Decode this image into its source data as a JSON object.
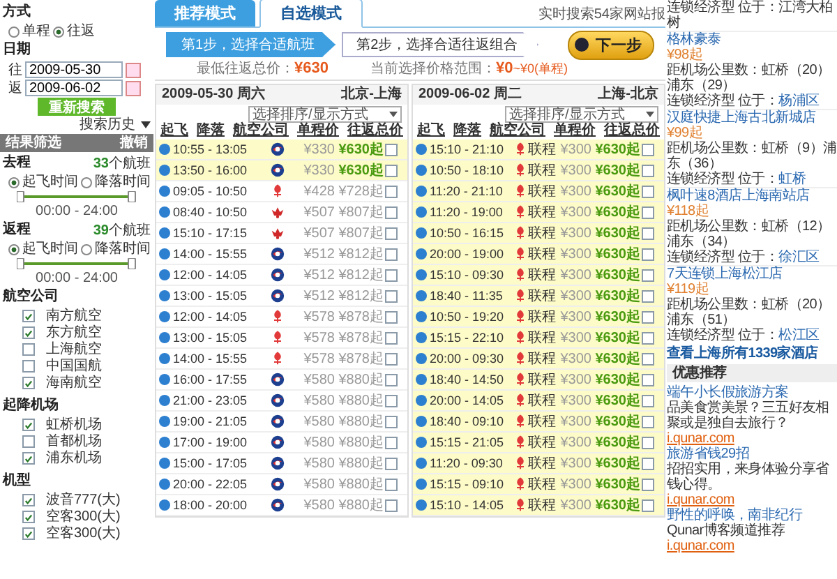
{
  "sidebar": {
    "trip_type": {
      "title": "方式",
      "options": [
        {
          "label": "单程",
          "selected": false
        },
        {
          "label": "往返",
          "selected": true
        }
      ]
    },
    "date": {
      "title": "日期",
      "fields": [
        {
          "label": "往",
          "value": "2009-05-30"
        },
        {
          "label": "返",
          "value": "2009-06-02"
        }
      ]
    },
    "search_button": "重新搜索",
    "history": "搜索历史",
    "filter": {
      "title": "结果筛选",
      "reset": "撤销"
    },
    "legs": [
      {
        "title": "去程",
        "count": "33",
        "unit": "个航班",
        "options": [
          {
            "label": "起飞时间",
            "selected": true
          },
          {
            "label": "降落时间",
            "selected": false
          }
        ],
        "thumbs": [
          {
            "level": 0
          },
          {
            "level": 1
          }
        ],
        "range": "00:00 - 24:00"
      },
      {
        "title": "返程",
        "count": "39",
        "unit": "个航班",
        "options": [
          {
            "label": "起飞时间",
            "selected": true
          },
          {
            "label": "降落时间",
            "selected": false
          }
        ],
        "thumbs": [
          {
            "level": 0
          },
          {
            "level": 1
          }
        ],
        "range": "00:00 - 24:00"
      }
    ],
    "groups": [
      {
        "title": "航空公司",
        "items": [
          {
            "label": "南方航空",
            "checked": true
          },
          {
            "label": "东方航空",
            "checked": true
          },
          {
            "label": "上海航空",
            "checked": false
          },
          {
            "label": "中国国航",
            "checked": false
          },
          {
            "label": "海南航空",
            "checked": true
          }
        ]
      },
      {
        "title": "起降机场",
        "items": [
          {
            "label": "虹桥机场",
            "checked": true
          },
          {
            "label": "首都机场",
            "checked": false
          },
          {
            "label": "浦东机场",
            "checked": true
          }
        ]
      },
      {
        "title": "机型",
        "items": [
          {
            "label": "波音777(大)",
            "checked": true
          },
          {
            "label": "空客300(大)",
            "checked": true
          },
          {
            "label": "空客300(大)",
            "checked": true
          }
        ]
      }
    ]
  },
  "main": {
    "tabs": [
      {
        "label": "推荐模式",
        "selected": false
      },
      {
        "label": "自选模式",
        "selected": true
      }
    ],
    "live_search": "实时搜索54家网站报",
    "steps": [
      {
        "label": "第1步，选择合适航班",
        "selected": true
      },
      {
        "label": "第2步，选择合适往返组合",
        "selected": false
      }
    ],
    "next_button": "下一步",
    "lowest_label": "最低往返总价：",
    "lowest_value": "¥630",
    "range_label": "当前选择价格范围：",
    "range_value": "¥0",
    "range_note": "~¥0(单程)",
    "legs": [
      {
        "date": "2009-05-30 周六",
        "route": "北京-上海",
        "sort_placeholder": "选择排序/显示方式",
        "columns": [
          "起飞",
          "降落",
          "航空公司",
          "单程价",
          "往返总价"
        ],
        "rows": [
          {
            "time": "10:55 - 13:05",
            "kind": "circle",
            "price": "¥330",
            "total": "¥630起",
            "highlighted": true,
            "checked": false
          },
          {
            "time": "13:50 - 16:00",
            "kind": "circle",
            "price": "¥330",
            "total": "¥630起",
            "highlighted": true,
            "checked": false
          },
          {
            "time": "09:05 - 10:50",
            "kind": "flower",
            "price": "¥428",
            "total": "¥728起",
            "highlighted": false,
            "checked": false
          },
          {
            "time": "08:40 - 10:50",
            "kind": "crab",
            "price": "¥507",
            "total": "¥807起",
            "highlighted": false,
            "checked": false
          },
          {
            "time": "15:10 - 17:15",
            "kind": "crab",
            "price": "¥507",
            "total": "¥807起",
            "highlighted": false,
            "checked": false
          },
          {
            "time": "14:00 - 15:55",
            "kind": "circle",
            "price": "¥512",
            "total": "¥812起",
            "highlighted": false,
            "checked": false
          },
          {
            "time": "12:00 - 14:05",
            "kind": "circle",
            "price": "¥512",
            "total": "¥812起",
            "highlighted": false,
            "checked": false
          },
          {
            "time": "13:00 - 15:05",
            "kind": "circle",
            "price": "¥512",
            "total": "¥812起",
            "highlighted": false,
            "checked": false
          },
          {
            "time": "12:00 - 14:05",
            "kind": "flower",
            "price": "¥578",
            "total": "¥878起",
            "highlighted": false,
            "checked": false
          },
          {
            "time": "13:00 - 15:05",
            "kind": "flower",
            "price": "¥578",
            "total": "¥878起",
            "highlighted": false,
            "checked": false
          },
          {
            "time": "14:00 - 15:55",
            "kind": "flower",
            "price": "¥578",
            "total": "¥878起",
            "highlighted": false,
            "checked": false
          },
          {
            "time": "16:00 - 17:55",
            "kind": "circle",
            "price": "¥580",
            "total": "¥880起",
            "highlighted": false,
            "checked": false
          },
          {
            "time": "21:00 - 23:05",
            "kind": "circle",
            "price": "¥580",
            "total": "¥880起",
            "highlighted": false,
            "checked": false
          },
          {
            "time": "19:00 - 21:05",
            "kind": "circle",
            "price": "¥580",
            "total": "¥880起",
            "highlighted": false,
            "checked": false
          },
          {
            "time": "17:00 - 19:00",
            "kind": "circle",
            "price": "¥580",
            "total": "¥880起",
            "highlighted": false,
            "checked": false
          },
          {
            "time": "15:00 - 17:05",
            "kind": "circle",
            "price": "¥580",
            "total": "¥880起",
            "highlighted": false,
            "checked": false
          },
          {
            "time": "20:00 - 22:05",
            "kind": "circle",
            "price": "¥580",
            "total": "¥880起",
            "highlighted": false,
            "checked": false
          },
          {
            "time": "18:00 - 20:00",
            "kind": "circle",
            "price": "¥580",
            "total": "¥880起",
            "highlighted": false,
            "checked": false
          }
        ]
      },
      {
        "date": "2009-06-02 周二",
        "route": "上海-北京",
        "sort_placeholder": "选择排序/显示方式",
        "columns": [
          "起飞",
          "降落",
          "航空公司",
          "单程价",
          "往返总价"
        ],
        "rows": [
          {
            "time": "15:10 - 21:10",
            "kind": "flower",
            "carrier": "联程",
            "price": "¥300",
            "total": "¥630起",
            "highlighted": true,
            "checked": false
          },
          {
            "time": "10:50 - 18:10",
            "kind": "flower",
            "carrier": "联程",
            "price": "¥300",
            "total": "¥630起",
            "highlighted": true,
            "checked": false
          },
          {
            "time": "11:20 - 21:10",
            "kind": "flower",
            "carrier": "联程",
            "price": "¥300",
            "total": "¥630起",
            "highlighted": true,
            "checked": false
          },
          {
            "time": "11:20 - 19:00",
            "kind": "flower",
            "carrier": "联程",
            "price": "¥300",
            "total": "¥630起",
            "highlighted": true,
            "checked": false
          },
          {
            "time": "10:50 - 16:15",
            "kind": "flower",
            "carrier": "联程",
            "price": "¥300",
            "total": "¥630起",
            "highlighted": true,
            "checked": false
          },
          {
            "time": "20:00 - 19:00",
            "kind": "flower",
            "carrier": "联程",
            "price": "¥300",
            "total": "¥630起",
            "highlighted": true,
            "checked": false
          },
          {
            "time": "15:10 - 09:30",
            "kind": "flower",
            "carrier": "联程",
            "price": "¥300",
            "total": "¥630起",
            "highlighted": true,
            "checked": false
          },
          {
            "time": "18:40 - 11:35",
            "kind": "flower",
            "carrier": "联程",
            "price": "¥300",
            "total": "¥630起",
            "highlighted": true,
            "checked": false
          },
          {
            "time": "10:50 - 19:20",
            "kind": "flower",
            "carrier": "联程",
            "price": "¥300",
            "total": "¥630起",
            "highlighted": true,
            "checked": false
          },
          {
            "time": "15:15 - 22:10",
            "kind": "flower",
            "carrier": "联程",
            "price": "¥300",
            "total": "¥630起",
            "highlighted": true,
            "checked": false
          },
          {
            "time": "20:00 - 09:30",
            "kind": "flower",
            "carrier": "联程",
            "price": "¥300",
            "total": "¥630起",
            "highlighted": true,
            "checked": false
          },
          {
            "time": "18:40 - 14:50",
            "kind": "flower",
            "carrier": "联程",
            "price": "¥300",
            "total": "¥630起",
            "highlighted": true,
            "checked": false
          },
          {
            "time": "20:00 - 14:05",
            "kind": "flower",
            "carrier": "联程",
            "price": "¥300",
            "total": "¥630起",
            "highlighted": true,
            "checked": false
          },
          {
            "time": "18:40 - 09:10",
            "kind": "flower",
            "carrier": "联程",
            "price": "¥300",
            "total": "¥630起",
            "highlighted": true,
            "checked": false
          },
          {
            "time": "15:15 - 21:05",
            "kind": "flower",
            "carrier": "联程",
            "price": "¥300",
            "total": "¥630起",
            "highlighted": true,
            "checked": false
          },
          {
            "time": "11:20 - 09:30",
            "kind": "flower",
            "carrier": "联程",
            "price": "¥300",
            "total": "¥630起",
            "highlighted": true,
            "checked": false
          },
          {
            "time": "15:15 - 09:10",
            "kind": "flower",
            "carrier": "联程",
            "price": "¥300",
            "total": "¥630起",
            "highlighted": true,
            "checked": false
          },
          {
            "time": "15:10 - 14:05",
            "kind": "flower",
            "carrier": "联程",
            "price": "¥300",
            "total": "¥630起",
            "highlighted": true,
            "checked": false
          }
        ]
      }
    ]
  },
  "hotels": {
    "top_line": "连锁经济型 位于：江湾大柏树",
    "items": [
      {
        "name": "格林豪泰",
        "price": "¥98起",
        "distance": "距机场公里数：虹桥（20）浦东（29）",
        "type": "连锁经济型 位于：",
        "area": "杨浦区"
      },
      {
        "name": "汉庭快捷上海古北新城店",
        "price": "¥99起",
        "distance": "距机场公里数：虹桥（9）浦东（36）",
        "type": "连锁经济型 位于：",
        "area": "虹桥"
      },
      {
        "name": "枫叶速8酒店上海南站店",
        "price": "¥118起",
        "distance": "距机场公里数：虹桥（12）浦东（34）",
        "type": "连锁经济型 位于：",
        "area": "徐汇区"
      },
      {
        "name": "7天连锁上海松江店",
        "price": "¥119起",
        "distance": "距机场公里数：虹桥（20）浦东（51）",
        "type": "连锁经济型 位于：",
        "area": "松江区"
      }
    ],
    "all_link": "查看上海所有1339家酒店",
    "promo_title": "优惠推荐",
    "promos": [
      {
        "title": "端午小长假旅游方案",
        "text": "品美食赏美景？三五好友相聚或是独自去旅行？",
        "source": "i.qunar.com"
      },
      {
        "title": "旅游省钱29招",
        "text": "招招实用，来身体验分享省钱心得。",
        "source": "i.qunar.com"
      },
      {
        "title": "野性的呼唤，南非纪行",
        "text": "Qunar博客频道推荐",
        "source": "i.qunar.com"
      }
    ]
  }
}
